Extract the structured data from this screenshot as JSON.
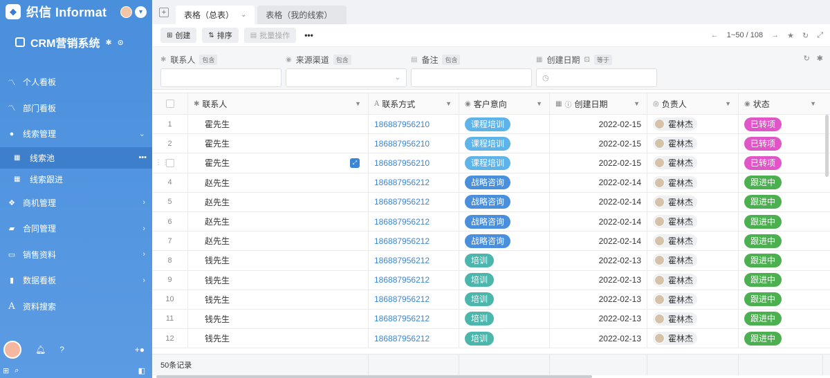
{
  "sidebar": {
    "brand": "织信 Informat",
    "logo_glyph": "◆",
    "app_title": "CRM营销系统",
    "nav": [
      {
        "label": "个人看板",
        "icon": "chart-line-icon"
      },
      {
        "label": "部门看板",
        "icon": "chart-line-icon"
      },
      {
        "label": "线索管理",
        "icon": "user-icon",
        "expanded": true
      },
      {
        "label": "商机管理",
        "icon": "cubes-icon"
      },
      {
        "label": "合同管理",
        "icon": "book-icon"
      },
      {
        "label": "销售资料",
        "icon": "folder-icon"
      },
      {
        "label": "数据看板",
        "icon": "bar-chart-icon"
      },
      {
        "label": "资料搜索",
        "icon": "font-icon"
      }
    ],
    "sub_items": [
      {
        "label": "线索池",
        "active": true
      },
      {
        "label": "线索跟进",
        "active": false
      }
    ]
  },
  "tabs": [
    {
      "label": "表格（总表）",
      "active": true
    },
    {
      "label": "表格（我的线索）",
      "active": false
    }
  ],
  "toolbar": {
    "create": "创建",
    "sort": "排序",
    "batch": "批量操作",
    "more": "•••",
    "pager": "1~50 / 108"
  },
  "filters": [
    {
      "label": "联系人",
      "tag": "包含"
    },
    {
      "label": "来源渠道",
      "tag": "包含"
    },
    {
      "label": "备注",
      "tag": "包含"
    },
    {
      "label": "创建日期",
      "tag": "等于"
    }
  ],
  "columns": {
    "contact": "联系人",
    "phone": "联系方式",
    "intent": "客户意向",
    "date": "创建日期",
    "owner": "负责人",
    "status": "状态"
  },
  "colors": {
    "pill_course": "#5eb3e8",
    "pill_strategy": "#4a8fdc",
    "pill_training": "#4db6ac",
    "status_converted": "#e055c8",
    "status_following": "#4caf50"
  },
  "rows": [
    {
      "n": "1",
      "contact": "霍先生",
      "phone": "186887956210",
      "intent": "课程培训",
      "date": "2022-02-15",
      "owner": "霍林杰",
      "status": "已转项"
    },
    {
      "n": "2",
      "contact": "霍先生",
      "phone": "186887956210",
      "intent": "课程培训",
      "date": "2022-02-15",
      "owner": "霍林杰",
      "status": "已转项"
    },
    {
      "n": "",
      "contact": "霍先生",
      "phone": "186887956210",
      "intent": "课程培训",
      "date": "2022-02-15",
      "owner": "霍林杰",
      "status": "已转项"
    },
    {
      "n": "4",
      "contact": "赵先生",
      "phone": "186887956212",
      "intent": "战略咨询",
      "date": "2022-02-14",
      "owner": "霍林杰",
      "status": "跟进中"
    },
    {
      "n": "5",
      "contact": "赵先生",
      "phone": "186887956212",
      "intent": "战略咨询",
      "date": "2022-02-14",
      "owner": "霍林杰",
      "status": "跟进中"
    },
    {
      "n": "6",
      "contact": "赵先生",
      "phone": "186887956212",
      "intent": "战略咨询",
      "date": "2022-02-14",
      "owner": "霍林杰",
      "status": "跟进中"
    },
    {
      "n": "7",
      "contact": "赵先生",
      "phone": "186887956212",
      "intent": "战略咨询",
      "date": "2022-02-14",
      "owner": "霍林杰",
      "status": "跟进中"
    },
    {
      "n": "8",
      "contact": "钱先生",
      "phone": "186887956212",
      "intent": "培训",
      "date": "2022-02-13",
      "owner": "霍林杰",
      "status": "跟进中"
    },
    {
      "n": "9",
      "contact": "钱先生",
      "phone": "186887956212",
      "intent": "培训",
      "date": "2022-02-13",
      "owner": "霍林杰",
      "status": "跟进中"
    },
    {
      "n": "10",
      "contact": "钱先生",
      "phone": "186887956212",
      "intent": "培训",
      "date": "2022-02-13",
      "owner": "霍林杰",
      "status": "跟进中"
    },
    {
      "n": "11",
      "contact": "钱先生",
      "phone": "186887956212",
      "intent": "培训",
      "date": "2022-02-13",
      "owner": "霍林杰",
      "status": "跟进中"
    },
    {
      "n": "12",
      "contact": "钱先生",
      "phone": "186887956212",
      "intent": "培训",
      "date": "2022-02-13",
      "owner": "霍林杰",
      "status": "跟进中"
    }
  ],
  "footer": {
    "count": "50条记录"
  }
}
